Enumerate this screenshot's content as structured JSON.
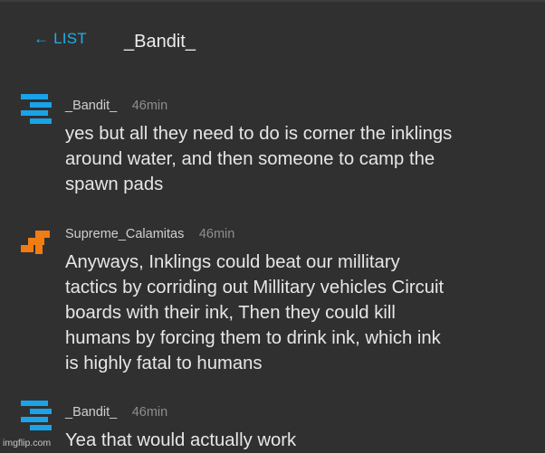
{
  "header": {
    "back_label": "← LIST",
    "title": "_Bandit_"
  },
  "messages": [
    {
      "user": "_Bandit_",
      "time": "46min",
      "avatar_icon": "blue-blocky-avatar-icon",
      "avatar_color": "#1aa3e8",
      "text": "yes but all they need to do is corner the inklings\naround water, and then someone to camp the\nspawn pads"
    },
    {
      "user": "Supreme_Calamitas",
      "time": "46min",
      "avatar_icon": "orange-blocky-avatar-icon",
      "avatar_color": "#f07c14",
      "text": "Anyways, Inklings could beat our millitary\ntactics by corriding out Millitary vehicles Circuit\nboards with their ink, Then they could kill\nhumans by forcing them to drink ink, which ink\nis highly fatal to humans"
    },
    {
      "user": "_Bandit_",
      "time": "46min",
      "avatar_icon": "blue-blocky-avatar-icon",
      "avatar_color": "#1aa3e8",
      "text": "Yea that would actually work"
    }
  ],
  "watermark": "imgflip.com"
}
